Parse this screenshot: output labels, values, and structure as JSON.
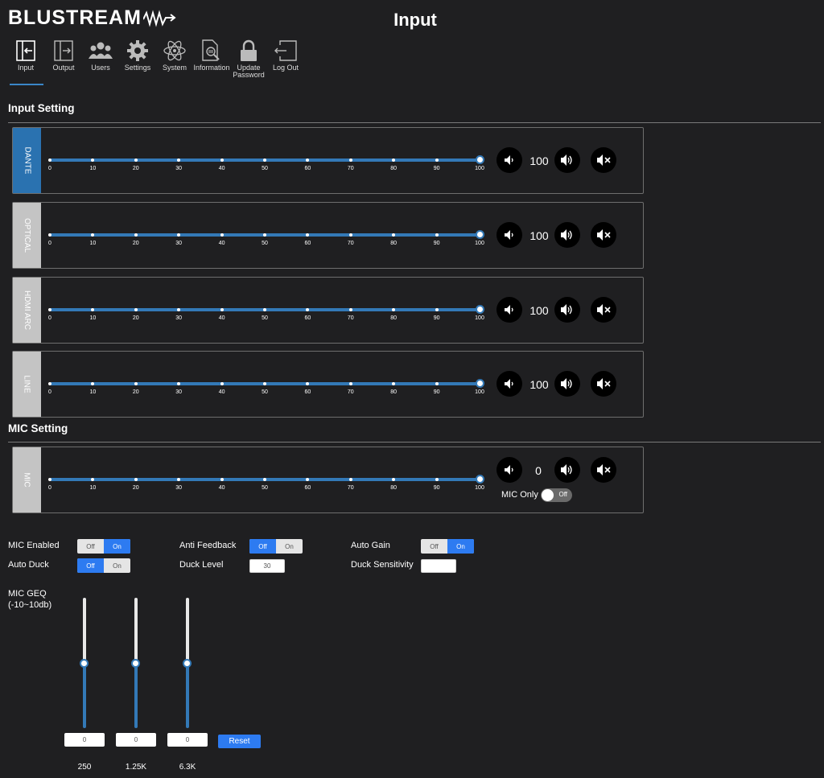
{
  "brand": "BLUSTREAM",
  "page_title": "Input",
  "nav": [
    {
      "label": "Input",
      "icon": "input-icon",
      "active": true
    },
    {
      "label": "Output",
      "icon": "output-icon"
    },
    {
      "label": "Users",
      "icon": "users-icon"
    },
    {
      "label": "Settings",
      "icon": "gear-icon"
    },
    {
      "label": "System",
      "icon": "atom-icon"
    },
    {
      "label": "Information",
      "icon": "document-search-icon"
    },
    {
      "label": "Update Password",
      "icon": "lock-icon"
    },
    {
      "label": "Log Out",
      "icon": "logout-icon"
    }
  ],
  "input_setting": {
    "title": "Input Setting",
    "scale_ticks": [
      "0",
      "10",
      "20",
      "30",
      "40",
      "50",
      "60",
      "70",
      "80",
      "90",
      "100"
    ],
    "channels": [
      {
        "name": "DANTE",
        "value": "100",
        "level": 100,
        "active": true
      },
      {
        "name": "OPTICAL",
        "value": "100",
        "level": 100
      },
      {
        "name": "HDMI ARC",
        "value": "100",
        "level": 100
      },
      {
        "name": "LINE",
        "value": "100",
        "level": 100
      }
    ]
  },
  "mic_setting": {
    "title": "MIC Setting",
    "channel": {
      "name": "MIC",
      "value": "0",
      "level": 100
    },
    "mic_only_label": "MIC Only",
    "mic_only_state": "Off"
  },
  "options": {
    "mic_enabled": {
      "label": "MIC Enabled",
      "off": "Off",
      "on": "On",
      "selected": "On"
    },
    "anti_feedback": {
      "label": "Anti Feedback",
      "off": "Off",
      "on": "On",
      "selected": "Off"
    },
    "auto_gain": {
      "label": "Auto Gain",
      "off": "Off",
      "on": "On",
      "selected": "On"
    },
    "auto_duck": {
      "label": "Auto Duck",
      "off": "Off",
      "on": "On",
      "selected": "Off"
    },
    "duck_level": {
      "label": "Duck Level",
      "value": "30"
    },
    "duck_sensitivity": {
      "label": "Duck Sensitivity",
      "value": ""
    }
  },
  "geq": {
    "label_line1": "MIC GEQ",
    "label_line2": "(-10~10db)",
    "bands": [
      {
        "freq": "250",
        "value": "0",
        "level": 0.5
      },
      {
        "freq": "1.25K",
        "value": "0",
        "level": 0.5
      },
      {
        "freq": "6.3K",
        "value": "0",
        "level": 0.5
      }
    ],
    "reset_label": "Reset"
  }
}
